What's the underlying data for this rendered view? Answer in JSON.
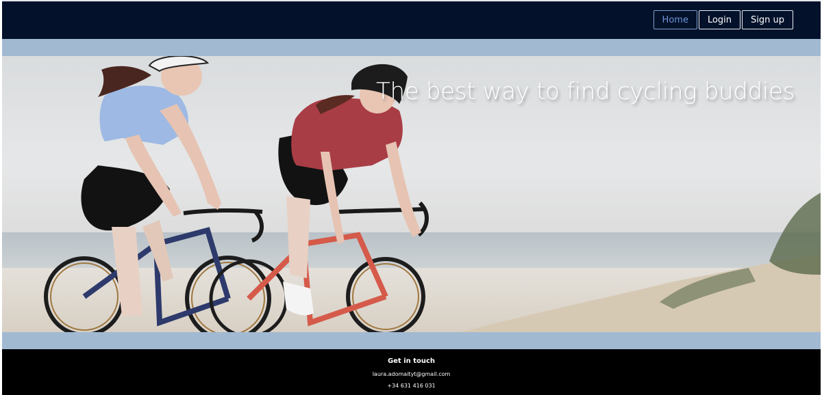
{
  "navbar": {
    "items": [
      {
        "label": "Home",
        "active": true
      },
      {
        "label": "Login",
        "active": false
      },
      {
        "label": "Sign up",
        "active": false
      }
    ]
  },
  "hero": {
    "title": "The best way to find cycling buddies",
    "image": "photo of two women cycling road bikes along a beach"
  },
  "footer": {
    "title": "Get in touch",
    "email": "laura.adomaityt@gmail.com",
    "phone": "+34 631 416 031"
  },
  "colors": {
    "navbar_bg": "#03112a",
    "band": "#a2b9d2",
    "footer_bg": "#000000",
    "active_link": "#6f95d6"
  }
}
